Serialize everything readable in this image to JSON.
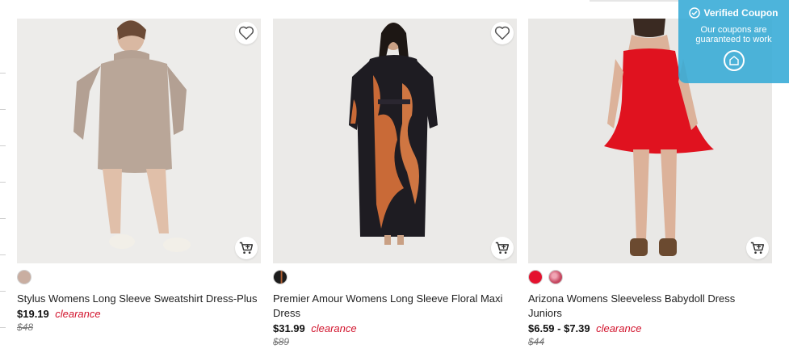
{
  "products": [
    {
      "title": "Stylus Womens Long Sleeve Sweatshirt Dress-Plus",
      "price": "$19.19",
      "price_note": "clearance",
      "original_price": "$48",
      "swatches": [
        "#c9aea1"
      ]
    },
    {
      "title": "Premier Amour Womens Long Sleeve Floral Maxi Dress",
      "price": "$31.99",
      "price_note": "clearance",
      "original_price": "$89",
      "swatches": [
        "#1c1c1c"
      ]
    },
    {
      "title": "Arizona Womens Sleeveless Babydoll Dress Juniors",
      "price": "$6.59 - $7.39",
      "price_note": "clearance",
      "original_price": "$44",
      "swatches": [
        "#e4122e",
        "#c5465f"
      ]
    }
  ],
  "coupon": {
    "title": "Verified Coupon",
    "message": "Our coupons are guaranteed to work"
  },
  "colors": {
    "clearance": "#d2142d",
    "coupon_bg": "#34aad6"
  },
  "icons": [
    "heart-icon",
    "add-to-cart-icon",
    "check-badge-icon",
    "coupon-logo-icon"
  ]
}
